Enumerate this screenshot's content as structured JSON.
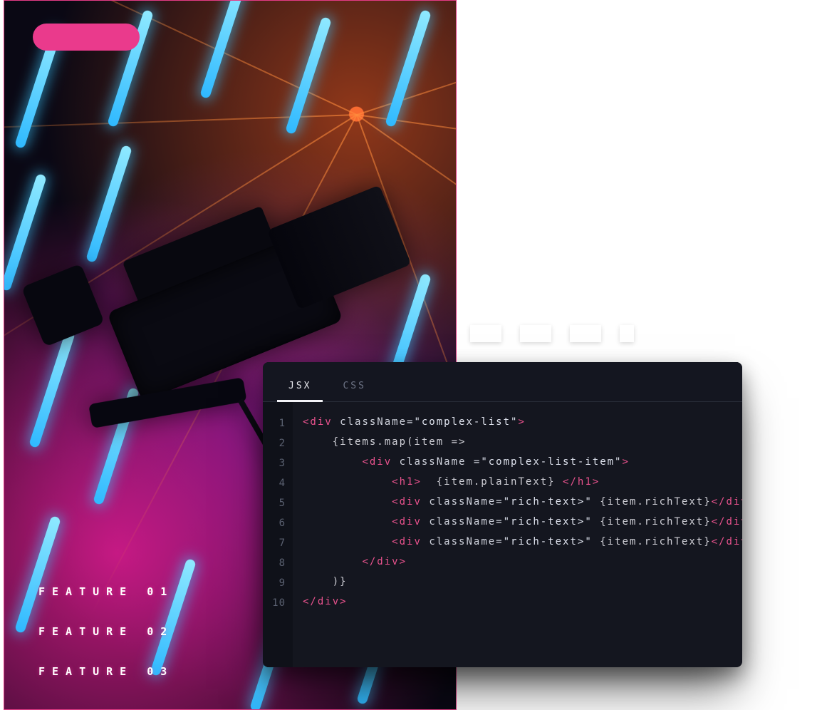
{
  "promo": {
    "pill_color": "#ea3a8c",
    "features": [
      "FEATURE 01",
      "FEATURE 02",
      "FEATURE 03"
    ]
  },
  "editor": {
    "tabs": [
      {
        "label": "JSX",
        "active": true
      },
      {
        "label": "CSS",
        "active": false
      }
    ],
    "line_numbers": [
      "1",
      "2",
      "3",
      "4",
      "5",
      "6",
      "7",
      "8",
      "9",
      "10"
    ],
    "code_lines": [
      {
        "indent": 0,
        "tokens": [
          {
            "c": "t-tag",
            "t": "<div "
          },
          {
            "c": "t-attr",
            "t": "className"
          },
          {
            "c": "t-punc",
            "t": "="
          },
          {
            "c": "t-str",
            "t": "\"complex-list\""
          },
          {
            "c": "t-tag",
            "t": ">"
          }
        ]
      },
      {
        "indent": 1,
        "tokens": [
          {
            "c": "t-expr",
            "t": "{items.map(item =>"
          }
        ]
      },
      {
        "indent": 2,
        "tokens": [
          {
            "c": "t-tag",
            "t": "<div "
          },
          {
            "c": "t-attr",
            "t": "className "
          },
          {
            "c": "t-punc",
            "t": "="
          },
          {
            "c": "t-str",
            "t": "\"complex-list-item\""
          },
          {
            "c": "t-tag",
            "t": ">"
          }
        ]
      },
      {
        "indent": 3,
        "tokens": [
          {
            "c": "t-tag",
            "t": "<h1>"
          },
          {
            "c": "t-expr",
            "t": "  {item.plainText} "
          },
          {
            "c": "t-tag",
            "t": "</h1>"
          }
        ]
      },
      {
        "indent": 3,
        "tokens": [
          {
            "c": "t-tag",
            "t": "<div "
          },
          {
            "c": "t-attr",
            "t": "className"
          },
          {
            "c": "t-punc",
            "t": "="
          },
          {
            "c": "t-str",
            "t": "\"rich-text>\" "
          },
          {
            "c": "t-expr",
            "t": "{item.richText}"
          },
          {
            "c": "t-tag",
            "t": "</div>"
          }
        ]
      },
      {
        "indent": 3,
        "tokens": [
          {
            "c": "t-tag",
            "t": "<div "
          },
          {
            "c": "t-attr",
            "t": "className"
          },
          {
            "c": "t-punc",
            "t": "="
          },
          {
            "c": "t-str",
            "t": "\"rich-text>\" "
          },
          {
            "c": "t-expr",
            "t": "{item.richText}"
          },
          {
            "c": "t-tag",
            "t": "</div>"
          }
        ]
      },
      {
        "indent": 3,
        "tokens": [
          {
            "c": "t-tag",
            "t": "<div "
          },
          {
            "c": "t-attr",
            "t": "className"
          },
          {
            "c": "t-punc",
            "t": "="
          },
          {
            "c": "t-str",
            "t": "\"rich-text>\" "
          },
          {
            "c": "t-expr",
            "t": "{item.richText}"
          },
          {
            "c": "t-tag",
            "t": "</div>"
          }
        ]
      },
      {
        "indent": 2,
        "tokens": [
          {
            "c": "t-tag",
            "t": "</div>"
          }
        ]
      },
      {
        "indent": 1,
        "tokens": [
          {
            "c": "t-expr",
            "t": ")}"
          }
        ]
      },
      {
        "indent": 0,
        "tokens": [
          {
            "c": "t-tag",
            "t": "</div>"
          }
        ]
      }
    ]
  },
  "colors": {
    "editor_bg": "#14161f",
    "accent_pink": "#e9528d"
  }
}
